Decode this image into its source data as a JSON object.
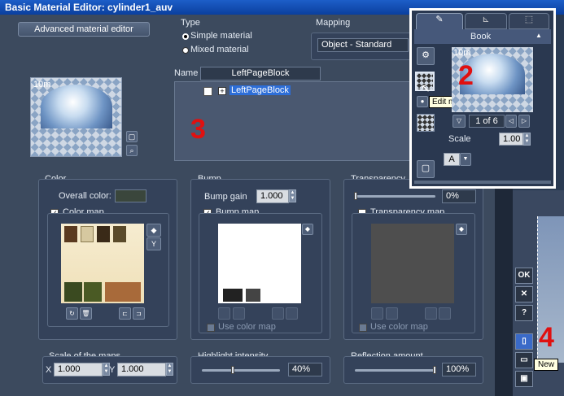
{
  "window": {
    "title": "Basic Material Editor: cylinder1_auv"
  },
  "header": {
    "advanced_button": "Advanced material editor",
    "type_label": "Type",
    "type_options": [
      "Simple material",
      "Mixed material"
    ],
    "mapping_label": "Mapping",
    "mapping_value": "Object - Standard",
    "name_label": "Name",
    "name_value": "LeftPageBlock",
    "tree_item": "LeftPageBlock"
  },
  "preview": {
    "scale_label": "10m"
  },
  "color": {
    "section_label": "Color",
    "overall_label": "Overall color:",
    "map_label": "Color map"
  },
  "bump": {
    "section_label": "Bump",
    "gain_label": "Bump gain",
    "gain_value": "1.000",
    "map_label": "Bump map",
    "use_color_label": "Use color map"
  },
  "transparency": {
    "section_label": "Transparency",
    "value": "0%",
    "map_label": "Transparency map",
    "use_color_label": "Use color map",
    "level": 0
  },
  "scale_maps": {
    "label": "Scale of the maps",
    "x_label": "X",
    "x_value": "1.000",
    "y_label": "Y",
    "y_value": "1.000"
  },
  "highlight": {
    "label": "Highlight intensity",
    "value": "40%",
    "level": 0.4
  },
  "reflection": {
    "label": "Reflection amount",
    "value": "100%",
    "level": 1.0
  },
  "side_buttons": {
    "ok": "OK",
    "help": "?",
    "tooltip_new": "New"
  },
  "popup": {
    "material_name": "Book",
    "preview_label": "10m",
    "tooltip": "Edit material",
    "page": "1 of 6",
    "scale_label": "Scale",
    "scale_value": "1.00",
    "layer_value": "A"
  },
  "annotations": {
    "n2": "2",
    "n3": "3",
    "n4": "4"
  }
}
